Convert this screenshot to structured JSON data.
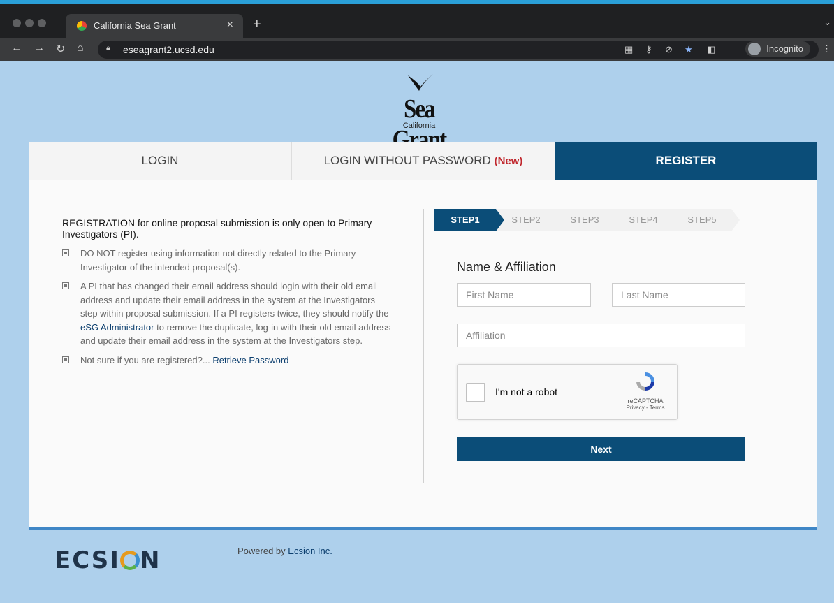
{
  "browser": {
    "tab_title": "California Sea Grant",
    "tab_close": "×",
    "new_tab": "+",
    "url": "eseagrant2.ucsd.edu",
    "incognito_label": "Incognito"
  },
  "logo": {
    "name": "Sea Grant",
    "sub": "California"
  },
  "tabs": {
    "login": "LOGIN",
    "login_without_password": "LOGIN WITHOUT PASSWORD",
    "new_badge": "(New)",
    "register": "REGISTER"
  },
  "info": {
    "lead": "REGISTRATION for online proposal submission is only open to Primary Investigators (PI).",
    "bullet1": "DO NOT register using information not directly related to the Primary Investigator of the intended proposal(s).",
    "bullet2_a": "A PI that has changed their email address should login with their old email address and update their email address in the system at the Investigators step within proposal submission. If a PI registers twice, they should notify the",
    "bullet2_link": "eSG Administrator",
    "bullet2_b": "to remove the duplicate, log-in with their old email address and update their email address in the system at the Investigators step.",
    "bullet3_a": "Not sure if you are registered?...",
    "bullet3_link": "Retrieve Password"
  },
  "steps": [
    "STEP1",
    "STEP2",
    "STEP3",
    "STEP4",
    "STEP5"
  ],
  "form": {
    "heading": "Name & Affiliation",
    "first_name_placeholder": "First Name",
    "last_name_placeholder": "Last Name",
    "affiliation_placeholder": "Affiliation",
    "captcha_label": "I'm not a robot",
    "captcha_brand": "reCAPTCHA",
    "captcha_links": "Privacy - Terms",
    "next_button": "Next"
  },
  "footer": {
    "logo_pre": "ECSI",
    "logo_post": "N",
    "powered_text": "Powered by",
    "powered_link": "Ecsion Inc."
  },
  "colors": {
    "brand_blue": "#0b4d78",
    "page_bg": "#aed0ec",
    "new_red": "#c0272d"
  }
}
